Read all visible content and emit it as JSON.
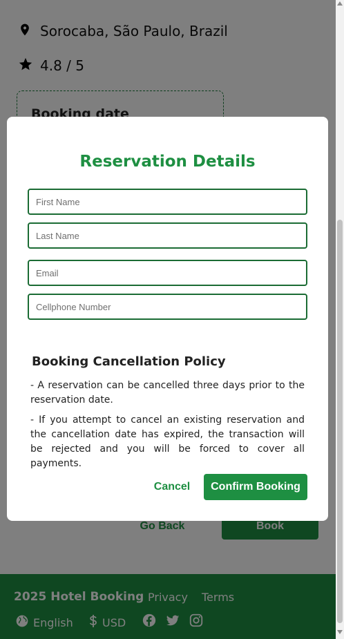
{
  "location": {
    "text": "Sorocaba, São Paulo, Brazil",
    "icon": "map-pin-icon"
  },
  "rating": {
    "text": "4.8 / 5",
    "icon": "star-icon"
  },
  "booking_card": {
    "title": "Booking date"
  },
  "background_actions": {
    "go_back_label": "Go Back",
    "book_label": "Book"
  },
  "modal": {
    "title": "Reservation Details",
    "fields": {
      "first_name_placeholder": "First Name",
      "last_name_placeholder": "Last Name",
      "email_placeholder": "Email",
      "cellphone_placeholder": "Cellphone Number"
    },
    "policy": {
      "title": "Booking Cancellation Policy",
      "paragraphs": [
        "- A reservation can be cancelled three days prior to the reservation date.",
        "- If you attempt to cancel an existing reservation and the cancellation date has expired, the transaction will be rejected and you will be forced to cover all payments."
      ]
    },
    "cancel_label": "Cancel",
    "confirm_label": "Confirm Booking"
  },
  "footer": {
    "brand": "2025 Hotel Booking",
    "links": [
      "Privacy",
      "Terms"
    ],
    "language": "English",
    "currency": "USD",
    "socials": [
      "facebook-icon",
      "twitter-icon",
      "instagram-icon"
    ]
  },
  "colors": {
    "accent": "#1e8f42",
    "field_border": "#1a6b33",
    "overlay": "rgba(0,0,0,0.5)"
  }
}
